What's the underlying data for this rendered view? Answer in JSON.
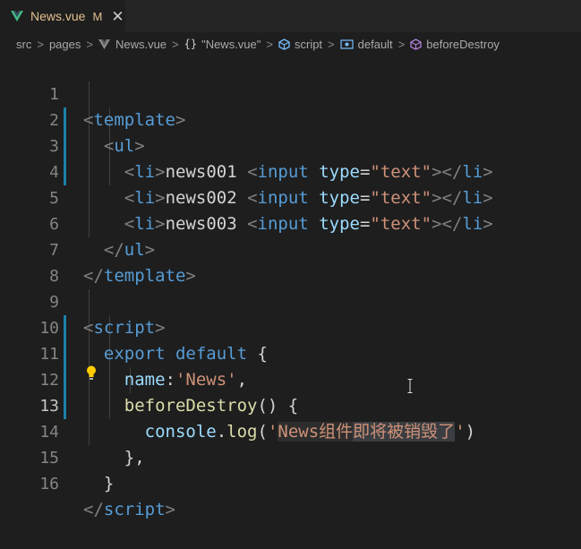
{
  "tab": {
    "title": "News.vue",
    "modified": "M",
    "close": "✕"
  },
  "breadcrumb": {
    "items": [
      "src",
      "pages",
      "News.vue",
      "\"News.vue\"",
      "script",
      "default",
      "beforeDestroy"
    ],
    "separator": ">"
  },
  "editor": {
    "active_line": 13,
    "line_numbers": [
      "1",
      "2",
      "3",
      "4",
      "5",
      "6",
      "7",
      "8",
      "9",
      "10",
      "11",
      "12",
      "13",
      "14",
      "15",
      "16"
    ],
    "code": {
      "l1": {
        "open": "<",
        "tag": "template",
        "close": ">"
      },
      "l2": {
        "open": "<",
        "tag": "ul",
        "close": ">"
      },
      "l3": {
        "text": "news001",
        "attr": "type",
        "eq": "=",
        "val": "\"text\""
      },
      "l4": {
        "text": "news002",
        "attr": "type",
        "eq": "=",
        "val": "\"text\""
      },
      "l5": {
        "text": "news003",
        "attr": "type",
        "eq": "=",
        "val": "\"text\""
      },
      "l6": {
        "tag": "ul"
      },
      "l7": {
        "tag": "template"
      },
      "l9": {
        "tag": "script"
      },
      "l10": {
        "kw1": "export",
        "kw2": "default",
        "brace": "{"
      },
      "l11": {
        "key": "name",
        "colon": ":",
        "val": "'News'",
        "comma": ","
      },
      "l12": {
        "fn": "beforeDestroy",
        "rest": "() {"
      },
      "l13": {
        "obj": "console",
        "dot": ".",
        "fn": "log",
        "open": "(",
        "q1": "'",
        "s1": "News组件",
        "s2": "即将被销毁了",
        "q2": "'",
        "close": ")"
      },
      "l14": {
        "text": "},"
      },
      "l15": {
        "text": "}"
      },
      "l16": {
        "tag": "script"
      },
      "li_tag": "li",
      "input_tag": "input"
    }
  },
  "colors": {
    "background": "#1e1e1e",
    "tag": "#569cd6",
    "attribute": "#9cdcfe",
    "string": "#ce9178",
    "function": "#dcdcaa",
    "modified": "#e2c08d"
  },
  "icons": [
    "vue-icon",
    "braces-icon",
    "script-icon",
    "default-icon",
    "method-icon",
    "lightbulb-icon",
    "text-cursor-icon"
  ]
}
